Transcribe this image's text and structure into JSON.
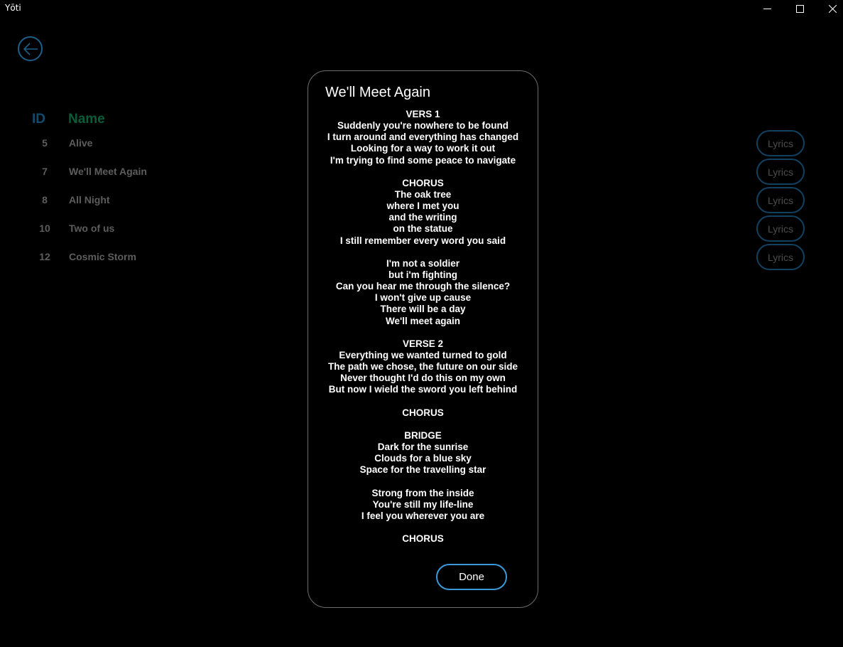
{
  "window": {
    "title": "Yōti"
  },
  "nav": {
    "back_icon": "arrow-left-icon"
  },
  "table": {
    "id_header": "ID",
    "name_header": "Name",
    "rows": [
      {
        "id": "5",
        "name": "Alive",
        "action": "Lyrics"
      },
      {
        "id": "7",
        "name": "We'll Meet Again",
        "action": "Lyrics"
      },
      {
        "id": "8",
        "name": "All Night",
        "action": "Lyrics"
      },
      {
        "id": "10",
        "name": "Two of us",
        "action": "Lyrics"
      },
      {
        "id": "12",
        "name": "Cosmic Storm",
        "action": "Lyrics"
      }
    ]
  },
  "dialog": {
    "title": "We'll Meet Again",
    "lyrics": [
      "VERS 1",
      "Suddenly you're nowhere to be found",
      "I turn around and everything has changed",
      "Looking for a way to work it out",
      "I'm trying to find some peace to navigate",
      "",
      "CHORUS",
      "The oak tree",
      "where I met you",
      "and the writing",
      "on the statue",
      "I still remember every word you said",
      "",
      "I'm not a soldier",
      "but i'm fighting",
      "Can you hear me through the silence?",
      "I won't give up cause",
      "There will be a day",
      "We'll meet again",
      "",
      "VERSE 2",
      "Everything we wanted turned to gold",
      "The path we chose, the future on our side",
      "Never thought I'd do this on my own",
      "But now I wield the sword you left behind",
      "",
      "CHORUS",
      "",
      "BRIDGE",
      "Dark for the sunrise",
      "Clouds for a blue sky",
      "Space for the travelling star",
      "",
      "Strong from the inside",
      "You're still my life-line",
      "I feel you wherever you are",
      "",
      "CHORUS"
    ],
    "done_label": "Done"
  },
  "colors": {
    "background": "#000000",
    "id_header": "#114b6d",
    "name_header": "#0a5b38",
    "row_text": "#5d5d5d",
    "accent": "#3a9ad9"
  }
}
